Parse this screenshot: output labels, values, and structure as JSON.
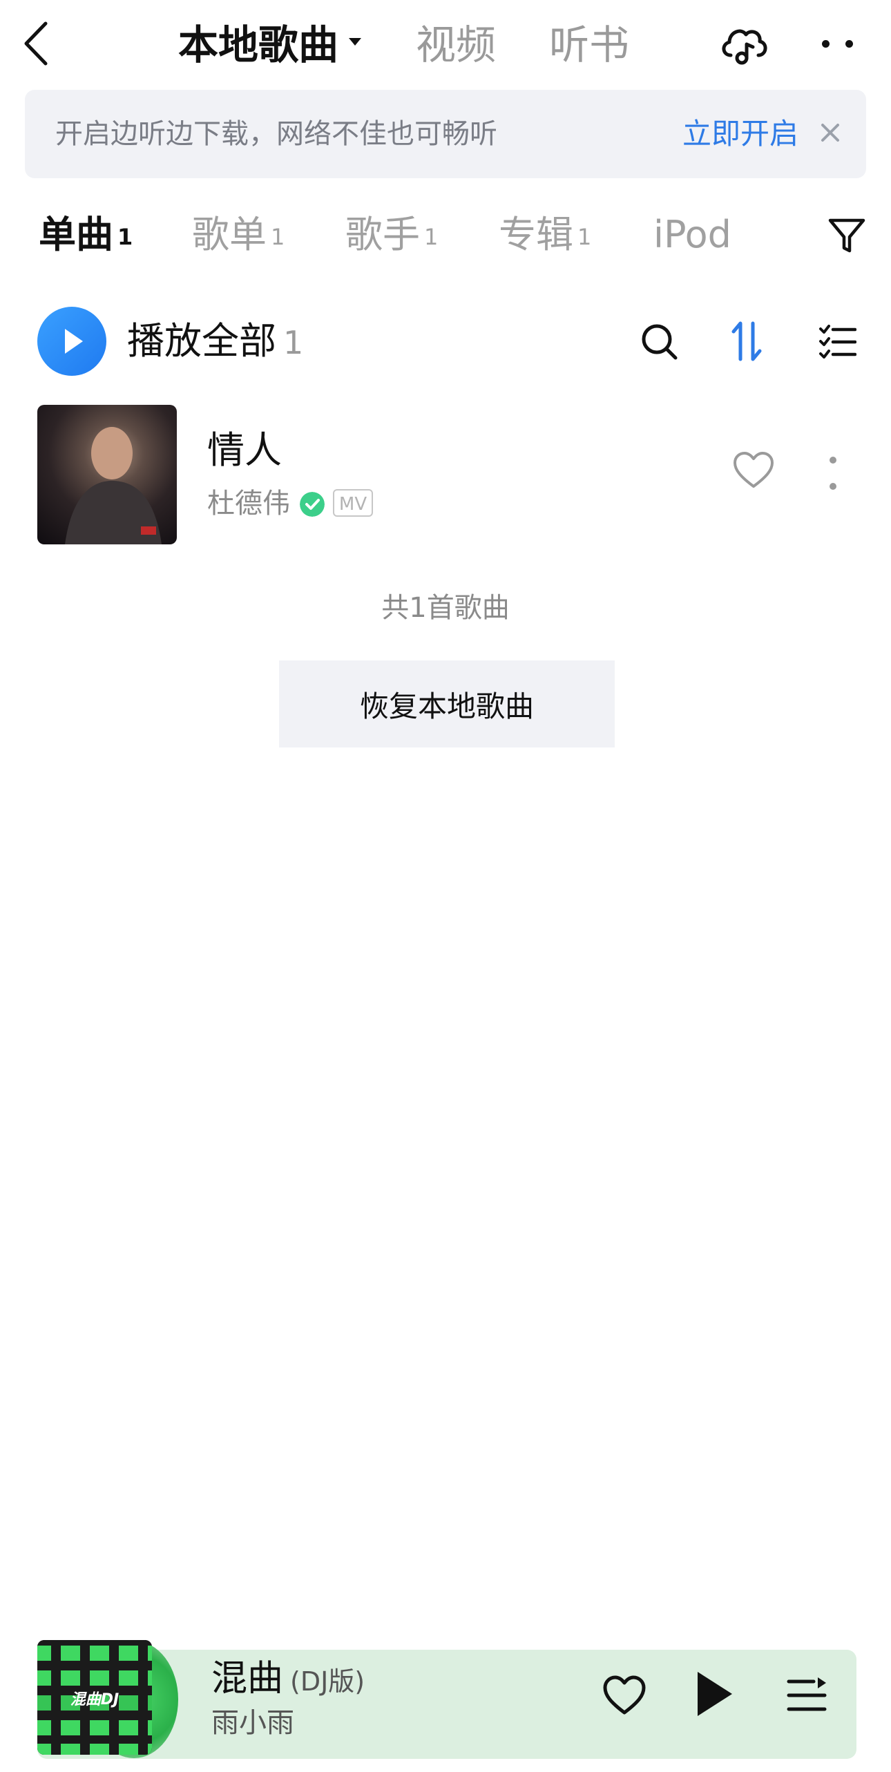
{
  "header": {
    "tabs": [
      {
        "label": "本地歌曲",
        "active": true
      },
      {
        "label": "视频",
        "active": false
      },
      {
        "label": "听书",
        "active": false
      }
    ],
    "icons": [
      "back-icon",
      "cloud-music-icon",
      "more-icon"
    ]
  },
  "banner": {
    "text": "开启边听边下载，网络不佳也可畅听",
    "action": "立即开启",
    "close_icon": "close-icon"
  },
  "categories": [
    {
      "label": "单曲",
      "count": "1",
      "active": true
    },
    {
      "label": "歌单",
      "count": "1",
      "active": false
    },
    {
      "label": "歌手",
      "count": "1",
      "active": false
    },
    {
      "label": "专辑",
      "count": "1",
      "active": false
    },
    {
      "label": "iPod",
      "count": "",
      "active": false
    }
  ],
  "play_all": {
    "label": "播放全部",
    "count": "1"
  },
  "songs": [
    {
      "title": "情人",
      "artist": "杜德伟",
      "badge": "MV",
      "verified": true
    }
  ],
  "list_footer": {
    "total": "共1首歌曲",
    "restore_button": "恢复本地歌曲"
  },
  "player": {
    "title": "混曲",
    "subtitle": "(DJ版)",
    "artist": "雨小雨",
    "cover_text": "混曲DJ"
  },
  "colors": {
    "accent": "#2e7be6",
    "verified": "#3ccf8a",
    "player_bg": "#dcefe0"
  }
}
